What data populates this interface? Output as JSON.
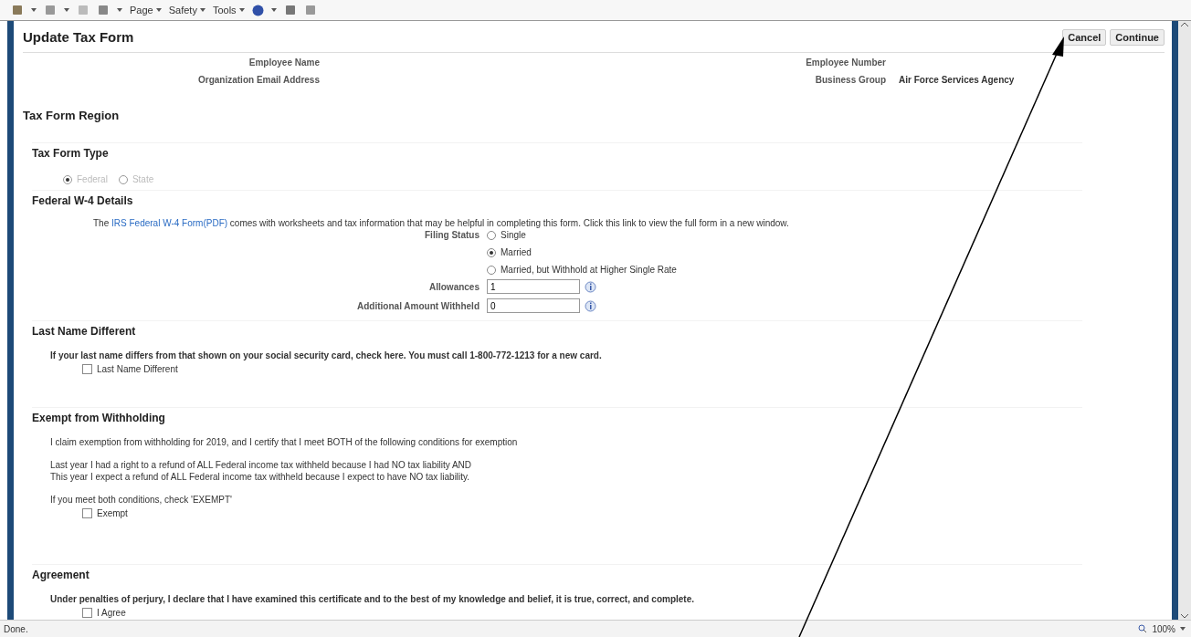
{
  "toolbar": {
    "menus": [
      "Page",
      "Safety",
      "Tools"
    ]
  },
  "header": {
    "title": "Update Tax Form",
    "buttons": [
      "Cancel",
      "Continue"
    ]
  },
  "info": {
    "left": [
      {
        "label": "Employee Name"
      },
      {
        "label": "Organization Email Address"
      }
    ],
    "right": [
      {
        "label": "Employee Number"
      },
      {
        "label": "Business Group",
        "value": "Air Force Services Agency"
      }
    ]
  },
  "region_title": "Tax Form Region",
  "tax_form_type": {
    "heading": "Tax Form Type",
    "disabled": true,
    "options": [
      {
        "label": "Federal",
        "selected": true
      },
      {
        "label": "State",
        "selected": false
      }
    ]
  },
  "w4": {
    "heading": "Federal W-4 Details",
    "intro_before": "The",
    "link": "IRS Federal W-4 Form(PDF)",
    "intro_after": "comes with worksheets and tax information that may be helpful in completing this form. Click this link to view the full form in a new window.",
    "filing_status": {
      "label": "Filing Status",
      "options": [
        {
          "label": "Single",
          "selected": false
        },
        {
          "label": "Married",
          "selected": true
        },
        {
          "label": "Married, but Withhold at Higher Single Rate",
          "selected": false
        }
      ]
    },
    "fields": [
      {
        "label": "Allowances",
        "value": "1"
      },
      {
        "label": "Additional Amount Withheld",
        "value": "0"
      }
    ]
  },
  "last_name": {
    "heading": "Last Name Different",
    "paragraphs": [
      "If your last name differs from that shown on your social security card, check here. You must call 1-800-772-1213 for a new card."
    ],
    "checkbox": {
      "label": "Last Name Different",
      "checked": false
    }
  },
  "exempt": {
    "heading": "Exempt from Withholding",
    "paragraphs": [
      "I claim exemption from withholding for 2019, and I certify that I meet BOTH of the following conditions for exemption",
      "Last year I had a right to a refund of ALL Federal income tax withheld because I had NO tax liability AND",
      "This year I expect a refund of ALL Federal income tax withheld because I expect to have NO tax liability.",
      "If you meet both conditions, check 'EXEMPT'"
    ],
    "checkbox": {
      "label": "Exempt",
      "checked": false
    }
  },
  "agreement": {
    "heading": "Agreement",
    "paragraphs": [
      "Under penalties of perjury, I declare that I have examined this certificate and to the best of my knowledge and belief, it is true, correct, and complete."
    ],
    "checkbox": {
      "label": "I Agree",
      "checked": false
    }
  },
  "status_bar": {
    "text": "Done.",
    "zoom": "100%"
  }
}
